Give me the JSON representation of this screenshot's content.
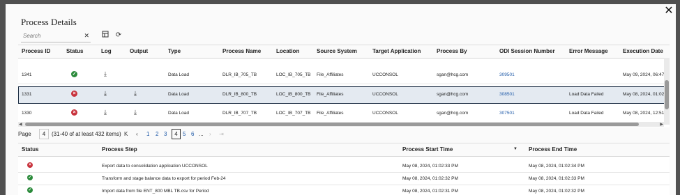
{
  "dialog": {
    "title": "Process Details",
    "close_label": "✕",
    "search_placeholder": "Search",
    "clear_label": "✕"
  },
  "grid": {
    "columns": [
      "Process ID",
      "Status",
      "Log",
      "Output",
      "Type",
      "Process Name",
      "Location",
      "Source System",
      "Target Application",
      "Process By",
      "ODI Session Number",
      "Error Message",
      "Execution Date"
    ],
    "rows": [
      {
        "id": "1341",
        "status": "success",
        "log": true,
        "output": false,
        "type": "Data Load",
        "name": "DLR_IB_705_TB",
        "location": "LOC_IB_705_TB",
        "source": "File_Affiliates",
        "target": "UCCONSOL",
        "by": "sgan@hcg.com",
        "odi": "309501",
        "error": "",
        "date": "May 09, 2024, 06:47"
      },
      {
        "id": "1331",
        "status": "error",
        "log": true,
        "output": true,
        "type": "Data Load",
        "name": "DLR_IB_800_TB",
        "location": "LOC_IB_800_TB",
        "source": "File_Affiliates",
        "target": "UCCONSOL",
        "by": "sgan@hcg.com",
        "odi": "308501",
        "error": "Load Data Failed",
        "date": "May 08, 2024, 01:02",
        "selected": true
      },
      {
        "id": "1330",
        "status": "error",
        "log": true,
        "output": true,
        "type": "Data Load",
        "name": "DLR_IB_707_TB",
        "location": "LOC_IB_707_TB",
        "source": "File_Affiliates",
        "target": "UCCONSOL",
        "by": "sgan@hcg.com",
        "odi": "307501",
        "error": "Load Data Failed",
        "date": "May 08, 2024, 12:51"
      }
    ]
  },
  "pager": {
    "page_label": "Page",
    "page_value": "4",
    "range_text": "(31-40 of at least 432 items)",
    "pages": [
      "1",
      "2",
      "3",
      "4",
      "5",
      "6",
      "..."
    ],
    "current": "4"
  },
  "steps": {
    "columns": [
      "Status",
      "Process Step",
      "Process Start Time",
      "Process End Time"
    ],
    "rows": [
      {
        "status": "error",
        "step": "Export data to consolidation application UCCONSOL",
        "start": "May 08, 2024, 01:02:33 PM",
        "end": "May 08, 2024, 01:02:34 PM"
      },
      {
        "status": "success",
        "step": "Transform and stage balance data to export for period Feb-24",
        "start": "May 08, 2024, 01:02:32 PM",
        "end": "May 08, 2024, 01:02:33 PM"
      },
      {
        "status": "success",
        "step": "Import data from file ENT_800 MBL TB.csv for Period",
        "start": "May 08, 2024, 01:02:31 PM",
        "end": "May 08, 2024, 01:02:32 PM"
      }
    ]
  }
}
